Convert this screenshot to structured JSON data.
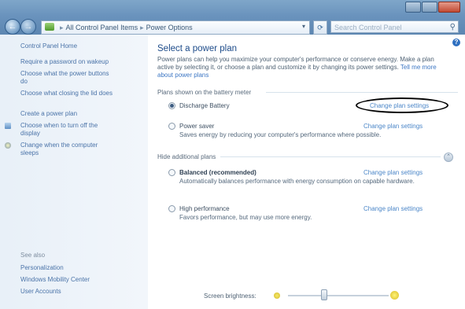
{
  "window": {
    "address_segments": [
      "All Control Panel Items",
      "Power Options"
    ],
    "search_placeholder": "Search Control Panel"
  },
  "left_pane": {
    "home_link": "Control Panel Home",
    "links": [
      "Require a password on wakeup",
      "Choose what the power buttons do",
      "Choose what closing the lid does",
      "Create a power plan",
      "Choose when to turn off the display",
      "Change when the computer sleeps"
    ],
    "see_also_label": "See also",
    "see_also_links": [
      "Personalization",
      "Windows Mobility Center",
      "User Accounts"
    ]
  },
  "main": {
    "title": "Select a power plan",
    "description": "Power plans can help you maximize your computer's performance or conserve energy. Make a plan active by selecting it, or choose a plan and customize it by changing its power settings.",
    "description_link": "Tell me more about power plans",
    "battery_group_label": "Plans shown on the battery meter",
    "additional_group_label": "Hide additional plans",
    "plans": [
      {
        "name": "Discharge Battery",
        "description": "",
        "change_link": "Change plan settings",
        "selected": true,
        "bold": false
      },
      {
        "name": "Power saver",
        "description": "Saves energy by reducing your computer's performance where possible.",
        "change_link": "Change plan settings",
        "selected": false,
        "bold": false
      },
      {
        "name": "Balanced (recommended)",
        "description": "Automatically balances performance with energy consumption on capable hardware.",
        "change_link": "Change plan settings",
        "selected": false,
        "bold": true
      },
      {
        "name": "High performance",
        "description": "Favors performance, but may use more energy.",
        "change_link": "Change plan settings",
        "selected": false,
        "bold": false
      }
    ],
    "brightness_label": "Screen brightness:",
    "brightness_level": 0.36
  },
  "colors": {
    "link": "#4a73a8",
    "title": "#1e4c8a",
    "chrome": "#6a93bd"
  },
  "icons": [
    "back-arrow-icon",
    "forward-arrow-icon",
    "control-panel-icon",
    "refresh-icon",
    "search-icon",
    "help-icon",
    "shield-icon",
    "display-icon",
    "moon-icon",
    "sun-icon"
  ]
}
